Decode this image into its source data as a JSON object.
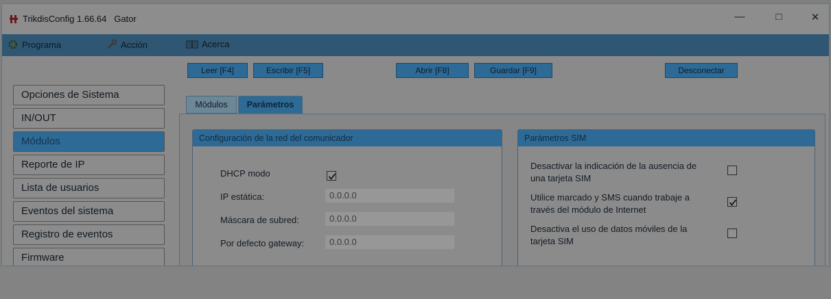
{
  "window": {
    "title": "TrikdisConfig 1.66.64",
    "device": "Gator",
    "minimize_icon": "minimize-icon",
    "maximize_icon": "maximize-icon",
    "close_icon": "close-icon"
  },
  "menu": {
    "programa": "Programa",
    "accion": "Acción",
    "acerca": "Acerca"
  },
  "toolbar": {
    "leer": "Leer [F4]",
    "escribir": "Escribir [F5]",
    "abrir": "Abrir [F8]",
    "guardar": "Guardar [F9]",
    "desconectar": "Desconectar"
  },
  "sidebar": {
    "items": [
      {
        "label": "Opciones de Sistema",
        "active": false
      },
      {
        "label": "IN/OUT",
        "active": false
      },
      {
        "label": "Módulos",
        "active": true
      },
      {
        "label": "Reporte de IP",
        "active": false
      },
      {
        "label": "Lista de usuarios",
        "active": false
      },
      {
        "label": "Eventos del sistema",
        "active": false
      },
      {
        "label": "Registro de eventos",
        "active": false
      },
      {
        "label": "Firmware",
        "active": false
      }
    ]
  },
  "tabs": [
    {
      "label": "Módulos",
      "active": false
    },
    {
      "label": "Parámetros",
      "active": true
    }
  ],
  "network": {
    "title": "Configuración de la red del comunicador",
    "dhcp_label": "DHCP modo",
    "dhcp_checked": true,
    "ip_label": "IP estática:",
    "ip_value": "0.0.0.0",
    "mask_label": "Máscara de subred:",
    "mask_value": "0.0.0.0",
    "gateway_label": "Por defecto gateway:",
    "gateway_value": "0.0.0.0"
  },
  "sim": {
    "title": "Parámetros SIM",
    "opt1_line1": "Desactivar la indicación de la ausencia de",
    "opt1_line2": "una tarjeta SIM",
    "opt1_checked": false,
    "opt2_line1": "Utilice marcado y SMS cuando trabaje a",
    "opt2_line2": "través del módulo de Internet",
    "opt2_checked": true,
    "opt3_line1": "Desactiva el uso de datos móviles de la",
    "opt3_line2": "tarjeta SIM",
    "opt3_checked": false
  },
  "colors": {
    "accent": "#2e6a96",
    "menubar": "#2f5673",
    "overlay_gray": "#8a8a8a"
  }
}
